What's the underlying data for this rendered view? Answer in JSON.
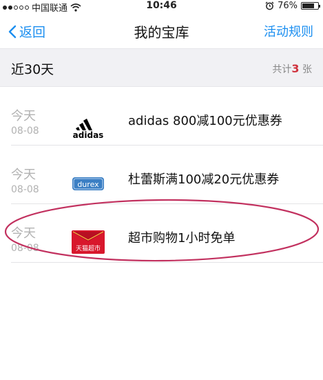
{
  "status_bar": {
    "carrier": "中国联通",
    "time": "10:46",
    "battery": "76%",
    "battery_level": 0.76
  },
  "nav": {
    "back_label": "返回",
    "title": "我的宝库",
    "right_label": "活动规则"
  },
  "section": {
    "title": "近30天",
    "count_prefix": "共计",
    "count_value": "3",
    "count_suffix": "张"
  },
  "coupons": [
    {
      "day": "今天",
      "date": "08-08",
      "logo": "adidas",
      "title": "adidas 800减100元优惠券"
    },
    {
      "day": "今天",
      "date": "08-08",
      "logo": "durex",
      "title": "杜蕾斯满100减20元优惠券"
    },
    {
      "day": "今天",
      "date": "08-08",
      "logo": "天猫超市",
      "title": "超市购物1小时免单"
    }
  ],
  "colors": {
    "accent": "#1a8ef0",
    "count_highlight": "#d0333e",
    "annotation": "#c2315f"
  }
}
